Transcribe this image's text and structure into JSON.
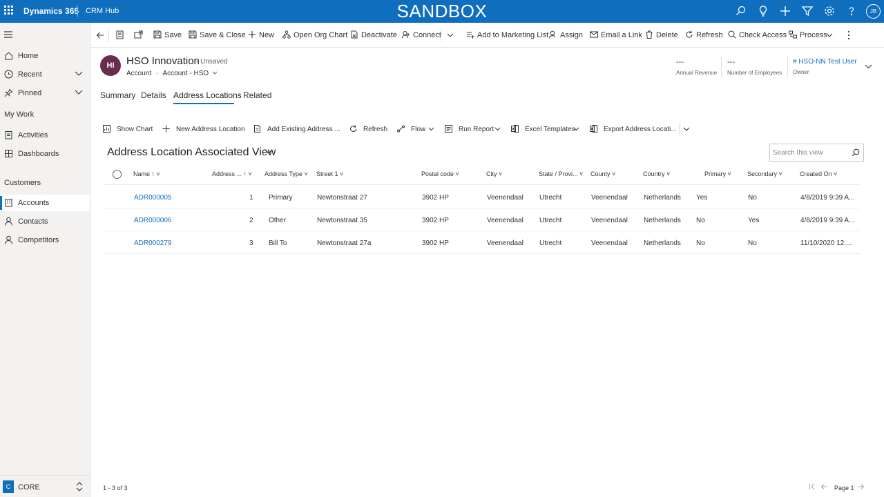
{
  "topbar": {
    "app_name": "Dynamics 365",
    "hub": "CRM Hub",
    "environment": "SANDBOX",
    "icons": [
      "search-icon",
      "lightbulb-icon",
      "plus-icon",
      "filter-icon",
      "gear-icon",
      "help-icon"
    ],
    "user_initials": "JB"
  },
  "sidebar": {
    "items": [
      {
        "label": "Home",
        "icon": "home-icon"
      },
      {
        "label": "Recent",
        "icon": "clock-icon"
      },
      {
        "label": "Pinned",
        "icon": "pin-icon"
      }
    ],
    "section_mywork": "My Work",
    "mywork": [
      {
        "label": "Activities",
        "icon": "activities-icon"
      },
      {
        "label": "Dashboards",
        "icon": "dashboard-icon"
      }
    ],
    "section_customers": "Customers",
    "customers": [
      {
        "label": "Accounts",
        "icon": "accounts-icon"
      },
      {
        "label": "Contacts",
        "icon": "contact-icon"
      },
      {
        "label": "Competitors",
        "icon": "competitor-icon"
      }
    ],
    "area_badge": "C",
    "area_label": "CORE"
  },
  "commands": {
    "save": "Save",
    "save_close": "Save & Close",
    "new": "New",
    "open_org_chart": "Open Org Chart",
    "deactivate": "Deactivate",
    "connect": "Connect",
    "add_marketing": "Add to Marketing List",
    "assign": "Assign",
    "email_link": "Email a Link",
    "delete": "Delete",
    "refresh": "Refresh",
    "check_access": "Check Access",
    "process": "Process"
  },
  "record": {
    "initials": "HI",
    "name": "HSO Innovation",
    "unsaved": "- Unsaved",
    "entity": "Account",
    "dot": "·",
    "form": "Account - HSO",
    "annual_revenue_value": "---",
    "annual_revenue_label": "Annual Revenue",
    "employees_value": "---",
    "employees_label": "Number of Employees",
    "owner_value": "# HSO-NN Test User",
    "owner_label": "Owner"
  },
  "tabs": [
    "Summary",
    "Details",
    "Address Locations",
    "Related"
  ],
  "subgrid_commands": {
    "show_chart": "Show Chart",
    "new_address": "New Address Location",
    "add_existing": "Add Existing Address ...",
    "refresh": "Refresh",
    "flow": "Flow",
    "run_report": "Run Report",
    "excel_templates": "Excel Templates",
    "export": "Export Address Locati..."
  },
  "view": {
    "title": "Address Location Associated View",
    "search_placeholder": "Search this view"
  },
  "grid": {
    "columns": [
      "Name",
      "Address ...",
      "Address Type",
      "Street 1",
      "Postal code",
      "City",
      "State / Provi...",
      "County",
      "Country",
      "Primary",
      "Secondary",
      "Created On"
    ],
    "rows": [
      [
        "ADR000005",
        "1",
        "Primary",
        "Newtonstraat 27",
        "3902 HP",
        "Veenendaal",
        "Utrecht",
        "Veenendaal",
        "Netherlands",
        "Yes",
        "No",
        "4/8/2019 9:39 A..."
      ],
      [
        "ADR000006",
        "2",
        "Other",
        "Newtonstraat 35",
        "3902 HP",
        "Veenendaal",
        "Utrecht",
        "Veenendaal",
        "Netherlands",
        "No",
        "Yes",
        "4/8/2019 9:39 A..."
      ],
      [
        "ADR000279",
        "3",
        "Bill To",
        "Newtonstraat 27a",
        "3902 HP",
        "Veenendaal",
        "Utrecht",
        "Veenendaal",
        "Netherlands",
        "No",
        "No",
        "11/10/2020 12:..."
      ]
    ]
  },
  "footer": {
    "count": "1 - 3 of 3",
    "page": "Page 1"
  }
}
